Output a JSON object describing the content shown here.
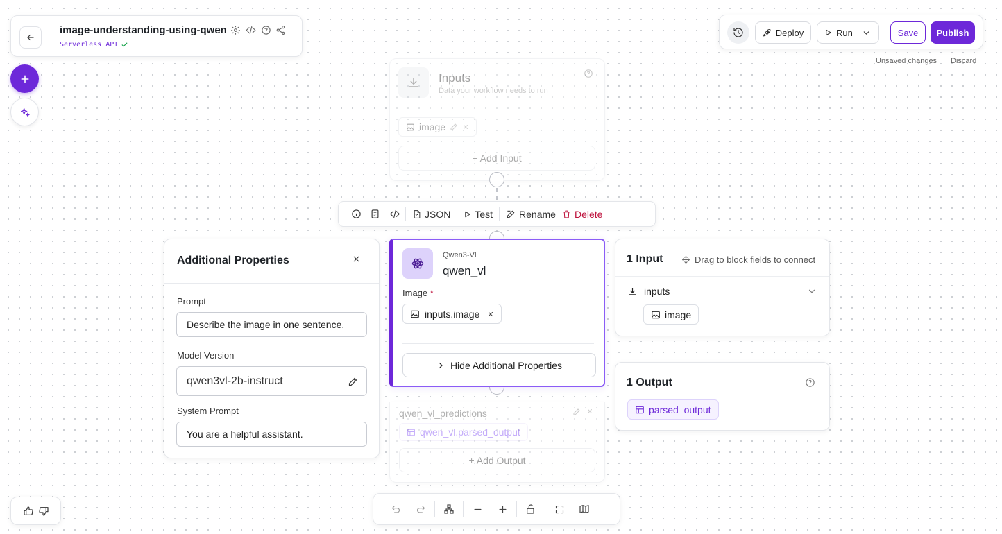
{
  "header": {
    "title": "image-understanding-using-qwen",
    "subtitle": "Serverless API"
  },
  "toolbar": {
    "deploy_label": "Deploy",
    "run_label": "Run",
    "save_label": "Save",
    "publish_label": "Publish",
    "unsaved_text": "Unsaved changes",
    "discard_label": "Discard"
  },
  "inputs_block": {
    "title": "Inputs",
    "description": "Data your workflow needs to run",
    "input_chip": "image",
    "add_input_label": "+ Add Input"
  },
  "block_toolbar": {
    "json_label": "JSON",
    "test_label": "Test",
    "rename_label": "Rename",
    "delete_label": "Delete"
  },
  "additional_properties": {
    "title": "Additional Properties",
    "prompt_label": "Prompt",
    "prompt_value": "Describe the image in one sentence.",
    "model_version_label": "Model Version",
    "model_version_value": "qwen3vl-2b-instruct",
    "system_prompt_label": "System Prompt",
    "system_prompt_value": "You are a helpful assistant."
  },
  "qwen_block": {
    "subtitle": "Qwen3-VL",
    "title": "qwen_vl",
    "image_label": "Image",
    "required_mark": "*",
    "image_chip": "inputs.image",
    "toggle_label": "Hide Additional Properties"
  },
  "outputs_block": {
    "name": "qwen_vl_predictions",
    "output_chip": "qwen_vl.parsed_output",
    "add_output_label": "+ Add Output"
  },
  "input_panel": {
    "title": "1 Input",
    "hint": "Drag to block fields to connect",
    "group_label": "inputs",
    "chip": "image"
  },
  "output_panel": {
    "title": "1 Output",
    "chip": "parsed_output"
  },
  "colors": {
    "accent": "#6d28d9",
    "accent_light": "#ddd2fb",
    "delete": "#be123c",
    "success": "#16a34a"
  }
}
